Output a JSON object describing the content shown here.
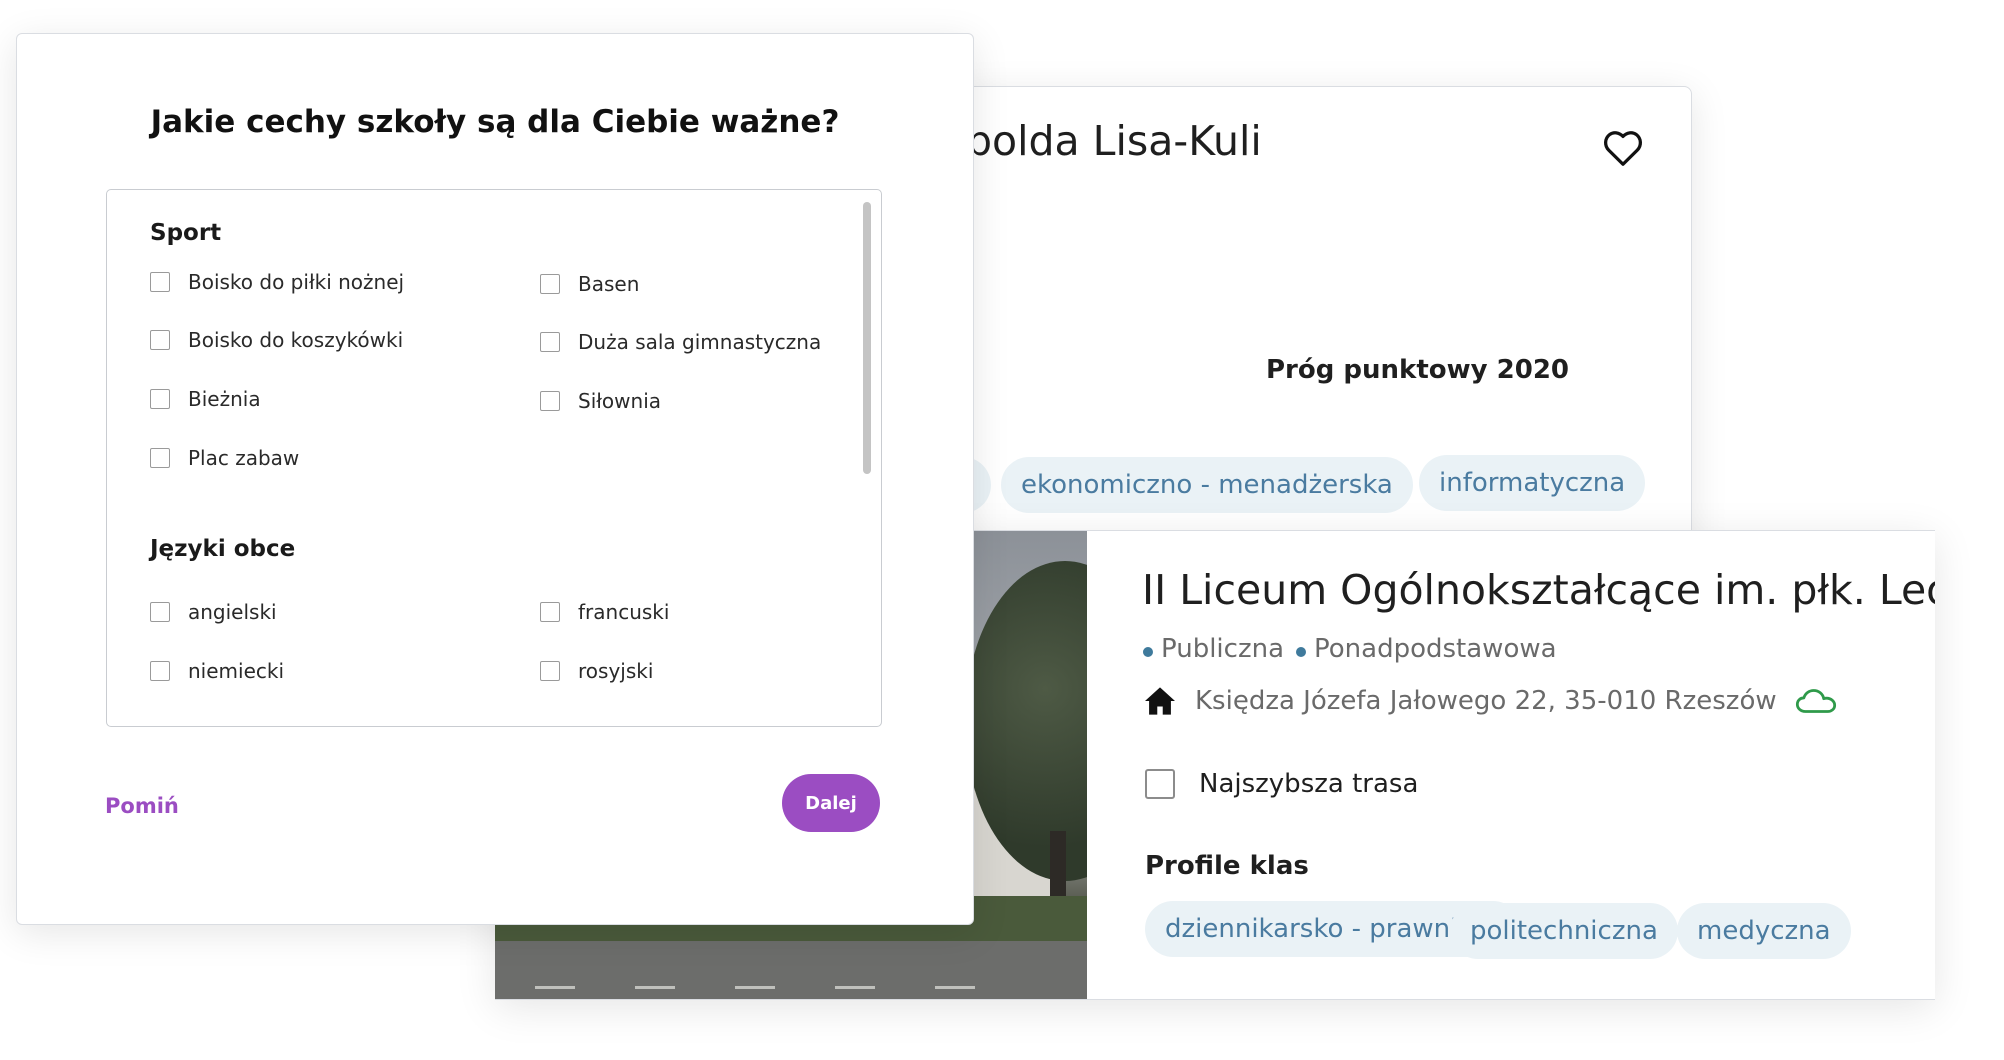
{
  "back_card": {
    "title": "polda Lisa-Kuli",
    "threshold_label": "Próg punktowy 2020",
    "chips": [
      "ekonomiczno - menadżerska",
      "informatyczna"
    ]
  },
  "front_card": {
    "school_name": "II Liceum Ogólnokształcące im. płk. Leop",
    "tags": [
      "Publiczna",
      "Ponadpodstawowa"
    ],
    "address": "Księdza Józefa Jałowego 22, 35-010 Rzeszów",
    "route_label": "Najszybsza trasa",
    "profiles_label": "Profile klas",
    "profiles": [
      "dziennikarsko - prawnicza",
      "politechniczna",
      "medyczna"
    ]
  },
  "modal": {
    "title": "Jakie cechy szkoły są dla Ciebie ważne?",
    "sections": [
      {
        "title": "Sport",
        "options": [
          "Boisko do piłki nożnej",
          "Basen",
          "Boisko do koszykówki",
          "Duża sala gimnastyczna",
          "Bieżnia",
          "Siłownia",
          "Plac zabaw"
        ]
      },
      {
        "title": "Języki obce",
        "options": [
          "angielski",
          "francuski",
          "niemiecki",
          "rosyjski"
        ]
      }
    ],
    "skip_label": "Pomiń",
    "next_label": "Dalej"
  },
  "colors": {
    "accent": "#9b4dc2",
    "chip_bg": "#eaf2f6",
    "chip_text": "#4a7ba0",
    "cloud_icon": "#2f9a4a"
  },
  "icons": [
    "heart-icon",
    "home-icon",
    "cloud-icon"
  ]
}
